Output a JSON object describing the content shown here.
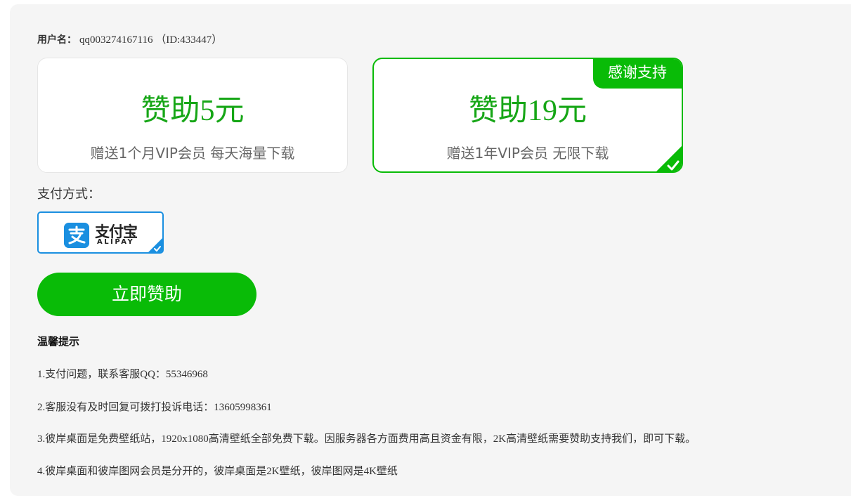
{
  "user": {
    "label": "用户名：",
    "value": "qq003274167116 （ID:433447）"
  },
  "plans": [
    {
      "title": "赞助5元",
      "desc": "赠送1个月VIP会员 每天海量下载",
      "selected": false
    },
    {
      "title": "赞助19元",
      "desc": "赠送1年VIP会员 无限下载",
      "badge": "感谢支持",
      "selected": true
    }
  ],
  "payment": {
    "label": "支付方式：",
    "method": {
      "name_cn": "支付宝",
      "name_en": "ALIPAY",
      "selected": true
    }
  },
  "submit_label": "立即赞助",
  "tips": {
    "title": "温馨提示",
    "items": [
      "1.支付问题，联系客服QQ：55346968",
      "2.客服没有及时回复可拨打投诉电话：13605998361",
      "3.彼岸桌面是免费壁纸站，1920x1080高清壁纸全部免费下载。因服务器各方面费用高且资金有限，2K高清壁纸需要赞助支持我们，即可下载。",
      "4.彼岸桌面和彼岸图网会员是分开的，彼岸桌面是2K壁纸，彼岸图网是4K壁纸"
    ]
  },
  "colors": {
    "accent": "#09bb07",
    "title_green": "#16a616",
    "alipay_blue": "#1a8fe0"
  }
}
